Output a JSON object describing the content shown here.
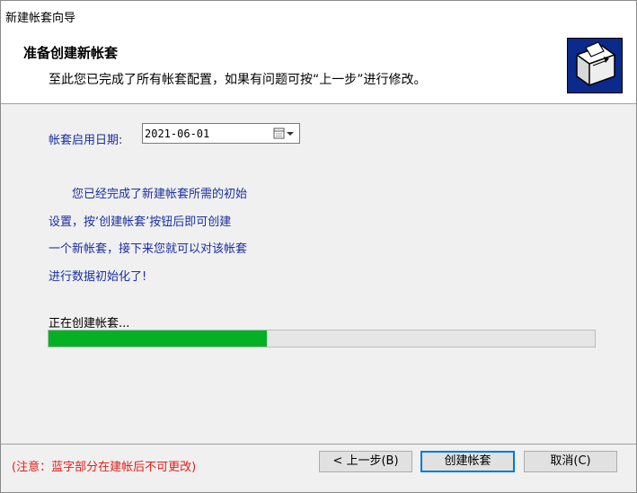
{
  "window": {
    "title": "新建帐套向导"
  },
  "header": {
    "title": "准备创建新帐套",
    "subtitle": "至此您已完成了所有帐套配置，如果有问题可按“上一步”进行修改。",
    "icon": "wizard-box-icon"
  },
  "form": {
    "date_label": "帐套启用日期:",
    "date_value": "2021-06-01",
    "date_picker_icon": "calendar-dropdown-icon"
  },
  "description": [
    "　　您已经完成了新建帐套所需的初始",
    "设置，按‘创建帐套’按钮后即可创建",
    "一个新帐套，接下来您就可以对该帐套",
    "进行数据初始化了!"
  ],
  "progress": {
    "label": "正在创建帐套...",
    "value_percent": 40
  },
  "footer": {
    "note": "(注意：蓝字部分在建帐后不可更改)",
    "prev_label": "< 上一步(B)",
    "create_label": "创建帐套",
    "cancel_label": "取消(C)"
  },
  "colors": {
    "accent_text": "#1a2fa0",
    "progress": "#06b025",
    "note": "#e0201a"
  }
}
